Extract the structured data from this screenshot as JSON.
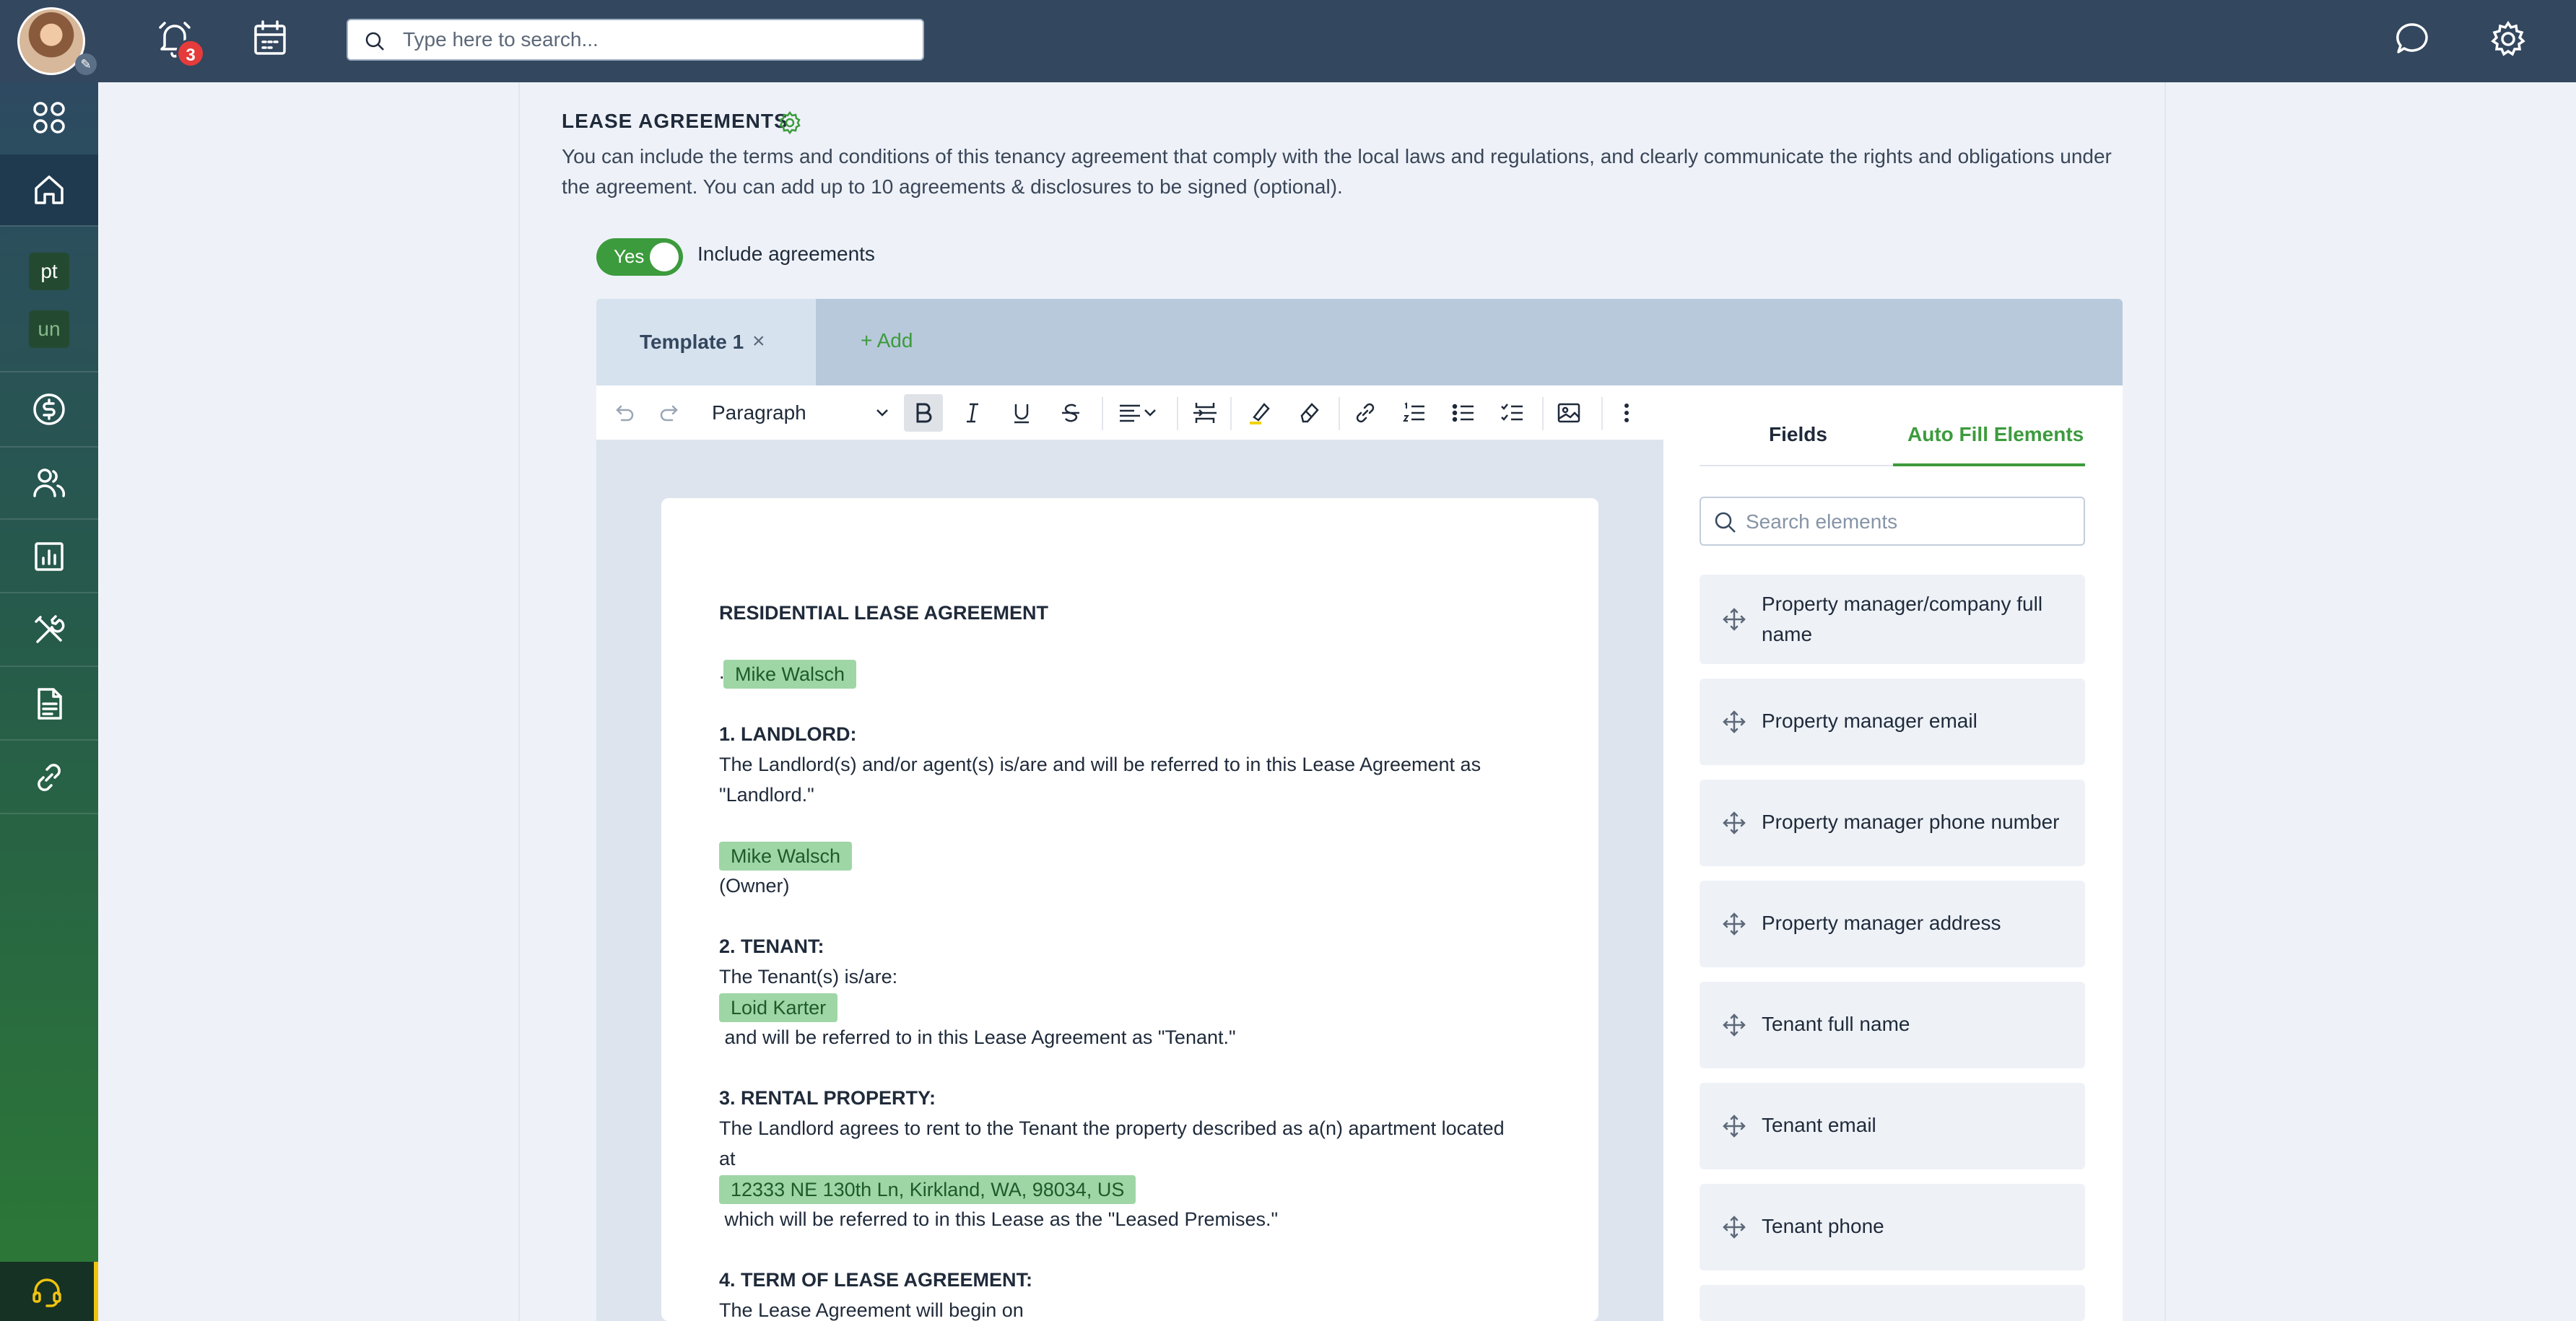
{
  "topbar": {
    "notification_count": "3",
    "search_placeholder": "Type here to search..."
  },
  "sidebar": {
    "chips": [
      "pt",
      "un"
    ]
  },
  "section": {
    "title": "LEASE AGREEMENTS",
    "description": "You can include the terms and conditions of this tenancy agreement that comply with the local laws and regulations, and clearly communicate the rights and obligations under the agreement. You can add up to 10 agreements & disclosures to be signed (optional).",
    "toggle_value": "Yes",
    "toggle_label": "Include agreements"
  },
  "tabs": {
    "active": "Template 1",
    "add": "+ Add"
  },
  "toolbar": {
    "paragraph_select": "Paragraph"
  },
  "document": {
    "title": "RESIDENTIAL LEASE AGREEMENT",
    "pill_top": "Mike Walsch",
    "landlord_heading": "1. LANDLORD:",
    "landlord_text_1": "The Landlord(s) and/or agent(s) is/are and will be referred to in this Lease Agreement as",
    "landlord_text_2": "\"Landlord.\"",
    "landlord_pill": "Mike Walsch",
    "owner": "(Owner)",
    "tenant_heading": "2. TENANT:",
    "tenant_text": "The Tenant(s) is/are:",
    "tenant_pill": "Loid Karter",
    "tenant_text_2": " and will be referred to in this Lease Agreement as \"Tenant.\"",
    "property_heading": "3. RENTAL PROPERTY:",
    "property_text_1": "The Landlord agrees to rent to the Tenant the property described as a(n) apartment located",
    "property_text_2": "at",
    "property_pill": "12333 NE 130th Ln, Kirkland, WA, 98034, US",
    "property_text_3": " which will be referred to in this Lease as the \"Leased Premises.\"",
    "term_heading": "4. TERM OF LEASE AGREEMENT:",
    "term_text": "The Lease Agreement will begin on"
  },
  "right_panel": {
    "tab_fields": "Fields",
    "tab_auto_fill": "Auto Fill Elements",
    "search_placeholder": "Search elements",
    "elements": [
      "Property manager/company full name",
      "Property manager email",
      "Property manager phone number",
      "Property manager address",
      "Tenant full name",
      "Tenant email",
      "Tenant phone"
    ]
  },
  "colors": {
    "topbar": "#33475f",
    "accent_green": "#3c9b3c",
    "pill_green": "#9fd6a6",
    "badge_red": "#e53b3b"
  }
}
